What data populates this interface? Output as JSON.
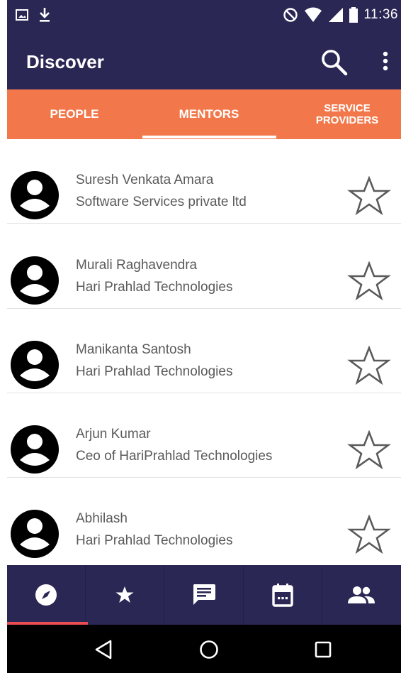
{
  "status_bar": {
    "time": "11:36",
    "icons": [
      "image-notification-icon",
      "download-icon",
      "do-not-disturb-icon",
      "wifi-icon",
      "signal-icon",
      "battery-icon"
    ]
  },
  "app_bar": {
    "title": "Discover",
    "icons": [
      "search-icon",
      "more-vert-icon"
    ],
    "background": "#2a2755"
  },
  "tabs": {
    "items": [
      {
        "label": "PEOPLE",
        "active": false
      },
      {
        "label": "MENTORS",
        "active": true
      },
      {
        "label_line1": "SERVICE",
        "label_line2": "PROVIDERS",
        "active": false
      }
    ],
    "background": "#f2784b"
  },
  "mentors": [
    {
      "name": "Suresh Venkata Amara",
      "company": "Software Services private ltd",
      "favorited": false
    },
    {
      "name": "Murali Raghavendra",
      "company": "Hari Prahlad Technologies",
      "favorited": false
    },
    {
      "name": "Manikanta Santosh",
      "company": "Hari Prahlad Technologies",
      "favorited": false
    },
    {
      "name": "Arjun Kumar",
      "company": "Ceo of HariPrahlad Technologies",
      "favorited": false
    },
    {
      "name": "Abhilash",
      "company": "Hari Prahlad Technologies",
      "favorited": false
    }
  ],
  "bottom_nav": {
    "items": [
      {
        "icon": "compass-icon",
        "active": true
      },
      {
        "icon": "star-icon",
        "active": false
      },
      {
        "icon": "message-icon",
        "active": false
      },
      {
        "icon": "calendar-icon",
        "active": false
      },
      {
        "icon": "people-icon",
        "active": false
      }
    ],
    "active_color": "#e84d52"
  },
  "system_nav": {
    "icons": [
      "back-icon",
      "home-icon",
      "recents-icon"
    ]
  }
}
